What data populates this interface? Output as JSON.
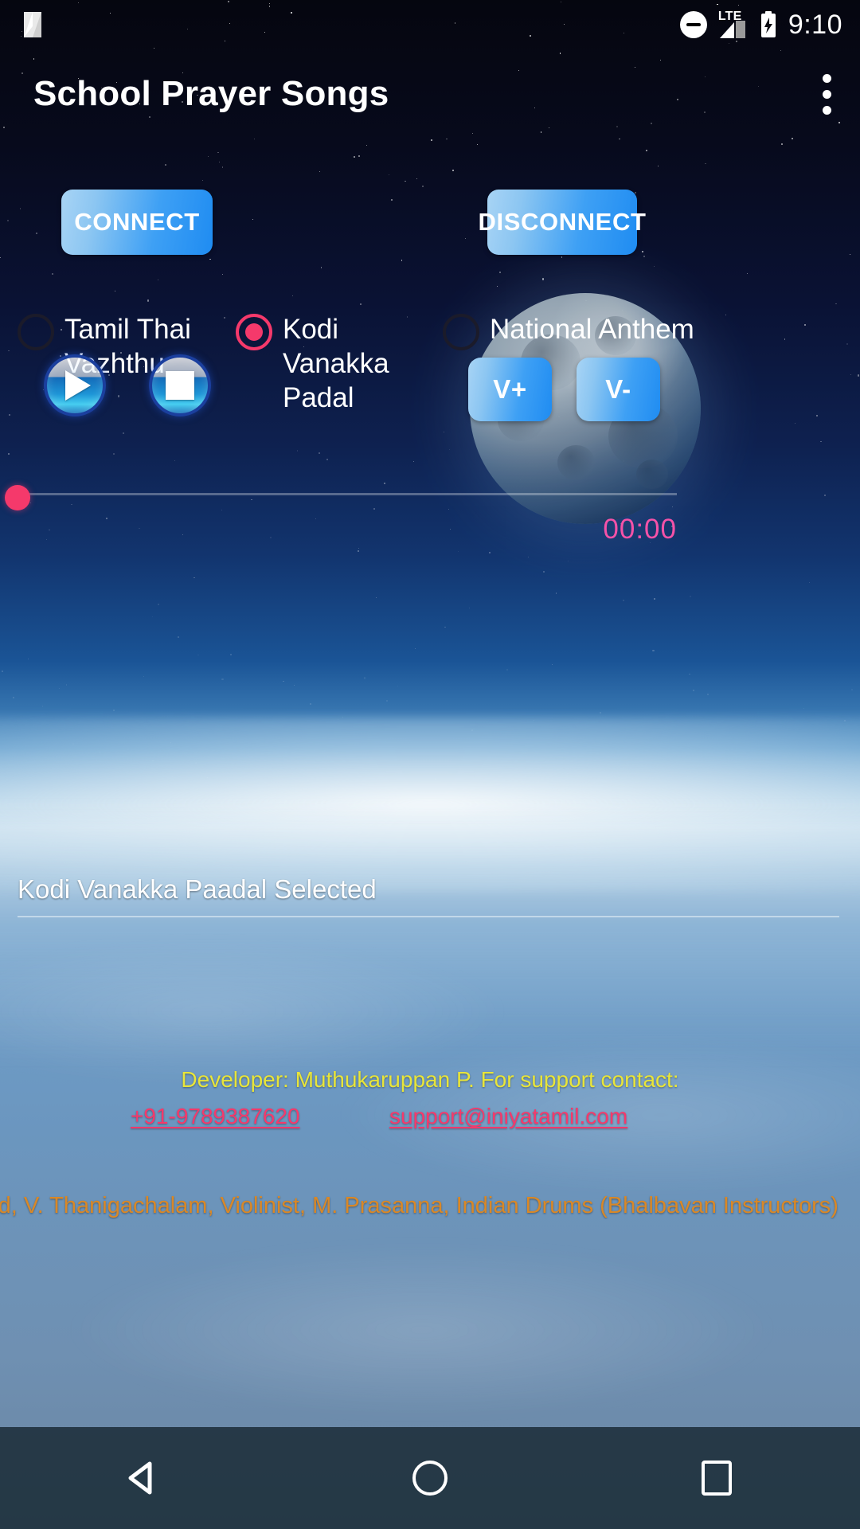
{
  "status_bar": {
    "app_icon": "nougat-n-logo-icon",
    "dnd_icon": "do-not-disturb-icon",
    "network_label": "LTE",
    "signal_icon": "signal-bars-icon",
    "battery_icon": "battery-charging-icon",
    "clock": "9:10"
  },
  "app_bar": {
    "title": "School Prayer Songs",
    "overflow_icon": "overflow-menu-icon"
  },
  "connection": {
    "connect_label": "CONNECT",
    "disconnect_label": "DISCONNECT"
  },
  "song_options": [
    {
      "label": "Tamil Thai Vazhthu",
      "selected": false
    },
    {
      "label": "Kodi Vanakka Padal",
      "selected": true
    },
    {
      "label": "National Anthem",
      "selected": false
    }
  ],
  "player": {
    "play_icon": "play-icon",
    "stop_icon": "stop-icon",
    "volume_up_label": "V+",
    "volume_down_label": "V-",
    "elapsed_time": "00:00",
    "seek_position_percent": 0
  },
  "status_message": "Kodi Vanakka Paadal Selected",
  "developer": {
    "line": "Developer: Muthukaruppan P. For support contact:",
    "phone": "+91-9789387620",
    "email": "support@iniyatamil.com"
  },
  "credits_marquee": "rd, V. Thanigachalam, Violinist, M. Prasanna, Indian Drums (Bhalbavan Instructors)",
  "navigation": {
    "back_icon": "back-triangle-icon",
    "home_icon": "home-circle-icon",
    "recents_icon": "recents-square-icon"
  },
  "colors": {
    "accent_pink": "#f5396b",
    "button_blue": "#2f9bf3",
    "credit_yellow": "#e8e53a",
    "marquee_orange": "#d98827",
    "time_pink": "#f552a8"
  }
}
